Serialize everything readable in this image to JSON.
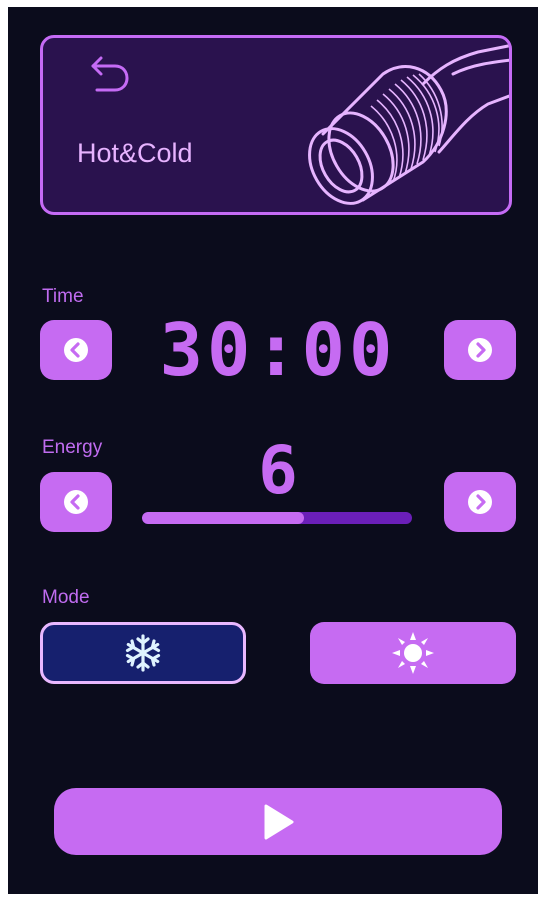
{
  "header": {
    "title": "Hot&Cold",
    "back_icon": "back-arrow-icon",
    "image": "roller-handpiece-illustration"
  },
  "time": {
    "label": "Time",
    "value": "30:00",
    "decrease_icon": "chevron-left-icon",
    "increase_icon": "chevron-right-icon"
  },
  "energy": {
    "label": "Energy",
    "value": "6",
    "level_fraction": 0.6,
    "decrease_icon": "chevron-left-icon",
    "increase_icon": "chevron-right-icon"
  },
  "mode": {
    "label": "Mode",
    "options": [
      {
        "name": "cold",
        "icon": "snowflake-icon",
        "selected": true
      },
      {
        "name": "hot",
        "icon": "sun-icon",
        "selected": false
      }
    ]
  },
  "start": {
    "icon": "play-icon"
  },
  "colors": {
    "background": "#0b0c1c",
    "accent": "#c66bf2",
    "card": "#2a124e",
    "selected_mode": "#16206e",
    "bar_track": "#6b1fb8"
  }
}
